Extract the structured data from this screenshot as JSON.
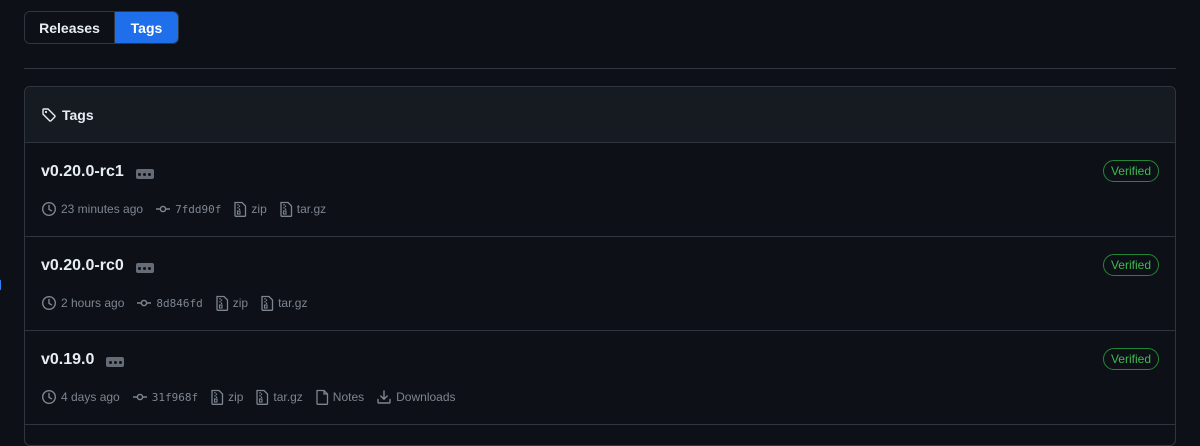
{
  "tabs": {
    "releases": "Releases",
    "tags": "Tags"
  },
  "box": {
    "title": "Tags"
  },
  "tags": [
    {
      "name": "v0.20.0-rc1",
      "verified": "Verified",
      "time": "23 minutes ago",
      "sha": "7fdd90f",
      "zip": "zip",
      "targz": "tar.gz"
    },
    {
      "name": "v0.20.0-rc0",
      "verified": "Verified",
      "time": "2 hours ago",
      "sha": "8d846fd",
      "zip": "zip",
      "targz": "tar.gz"
    },
    {
      "name": "v0.19.0",
      "verified": "Verified",
      "time": "4 days ago",
      "sha": "31f968f",
      "zip": "zip",
      "targz": "tar.gz",
      "notes": "Notes",
      "downloads": "Downloads"
    }
  ],
  "colors": {
    "accent": "#1f6feb",
    "verified": "#3fb950",
    "background": "#0d1117",
    "border": "#30363d"
  }
}
